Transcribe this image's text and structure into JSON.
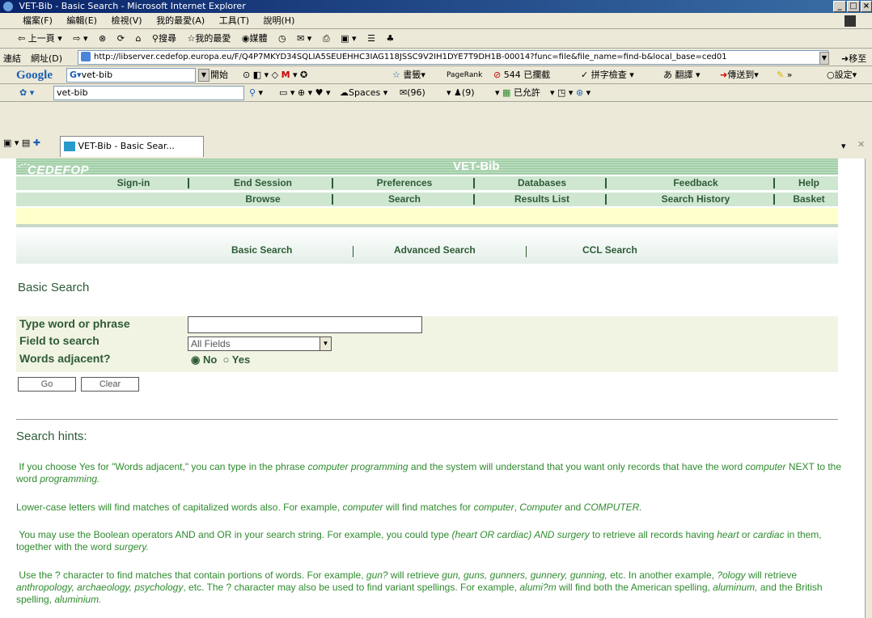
{
  "window": {
    "title": "VET-Bib - Basic Search - Microsoft Internet Explorer",
    "min": "_",
    "max": "□",
    "close": "×"
  },
  "menu": [
    "檔案(F)",
    "編輯(E)",
    "檢視(V)",
    "我的最愛(A)",
    "工具(T)",
    "說明(H)"
  ],
  "toolbar": {
    "back": "上一頁",
    "search": "搜尋",
    "favorites": "我的最愛",
    "media": "媒體"
  },
  "address": {
    "label": "網址(D)",
    "links_label": "連結",
    "url": "http://libserver.cedefop.europa.eu/F/Q4P7MKYD34SQLIA5SEUEHHC3IAG118JSSC9V2IH1DYE7T9DH1B-00014?func=file&file_name=find-b&local_base=ced01",
    "go": "移至"
  },
  "google": {
    "logo": "Google",
    "query": "vet-bib",
    "start": "開始",
    "bookmarks": "書籤",
    "pagerank": "PageRank",
    "blocked": "544 已攔截",
    "spell": "拼字檢查",
    "translate": "翻譯",
    "send": "傳送到",
    "settings": "設定"
  },
  "livebar": {
    "query": "vet-bib",
    "spaces": "Spaces",
    "mail_count": "(96)",
    "contacts_count": "(9)",
    "allowed": "已允許"
  },
  "tab": {
    "label": "VET-Bib - Basic Sear..."
  },
  "site": {
    "logo": "CEDEFOP",
    "banner": "VET-Bib",
    "nav1": [
      "Sign-in",
      "End Session",
      "Preferences",
      "Databases",
      "Feedback",
      "Help"
    ],
    "nav2": [
      "Browse",
      "Search",
      "Results List",
      "Search History",
      "Basket"
    ],
    "subnav": [
      "Basic Search",
      "Advanced Search",
      "CCL Search"
    ]
  },
  "form": {
    "heading": "Basic Search",
    "word_label": "Type word or phrase",
    "word_value": "",
    "field_label": "Field to search",
    "field_selected": "All Fields",
    "adjacent_label": "Words adjacent?",
    "adjacent_no": "No",
    "adjacent_yes": "Yes",
    "adjacent_selected": "No",
    "go": "Go",
    "clear": "Clear"
  },
  "hints": {
    "heading": "Search hints:",
    "p1a": "If you choose Yes for \"Words adjacent,\" you can type in the phrase ",
    "p1b": "computer programming",
    "p1c": " and the system will understand that you want only records that have the word ",
    "p1d": "computer",
    "p1e": " NEXT to the word ",
    "p1f": "programming.",
    "p2a": "Lower-case letters will find matches of capitalized words also. For example, ",
    "p2b": "computer",
    "p2c": " will find matches for ",
    "p2d": "computer",
    "p2e": ", ",
    "p2f": "Computer",
    "p2g": " and ",
    "p2h": "COMPUTER.",
    "p3a": "You may use the Boolean operators AND and OR in your search string. For example, you could type ",
    "p3b": "(heart OR cardiac) AND surgery",
    "p3c": " to retrieve all records having ",
    "p3d": "heart",
    "p3e": " or ",
    "p3f": "cardiac",
    "p3g": " in them, together with the word ",
    "p3h": "surgery.",
    "p4a": "Use the ? character to find matches that contain portions of words. For example, ",
    "p4b": "gun?",
    "p4c": " will retrieve ",
    "p4d": "gun, guns, gunners, gunnery, gunning,",
    "p4e": " etc. In another example, ",
    "p4f": "?ology",
    "p4g": " will retrieve ",
    "p4h": "anthropology, archaeology, psychology",
    "p4i": ", etc. The ? character may also be used to find variant spellings. For example, ",
    "p4j": "alumi?m",
    "p4k": " will find both the American spelling, ",
    "p4l": "aluminum,",
    "p4m": " and the British spelling, ",
    "p4n": "aluminium."
  },
  "colors": {
    "accent": "#2e5b36",
    "nav_bg": "#cfe6d1",
    "form_bg": "#f1f4e3",
    "hint_text": "#2e8b2e",
    "yellow_band": "#ffffcc"
  }
}
